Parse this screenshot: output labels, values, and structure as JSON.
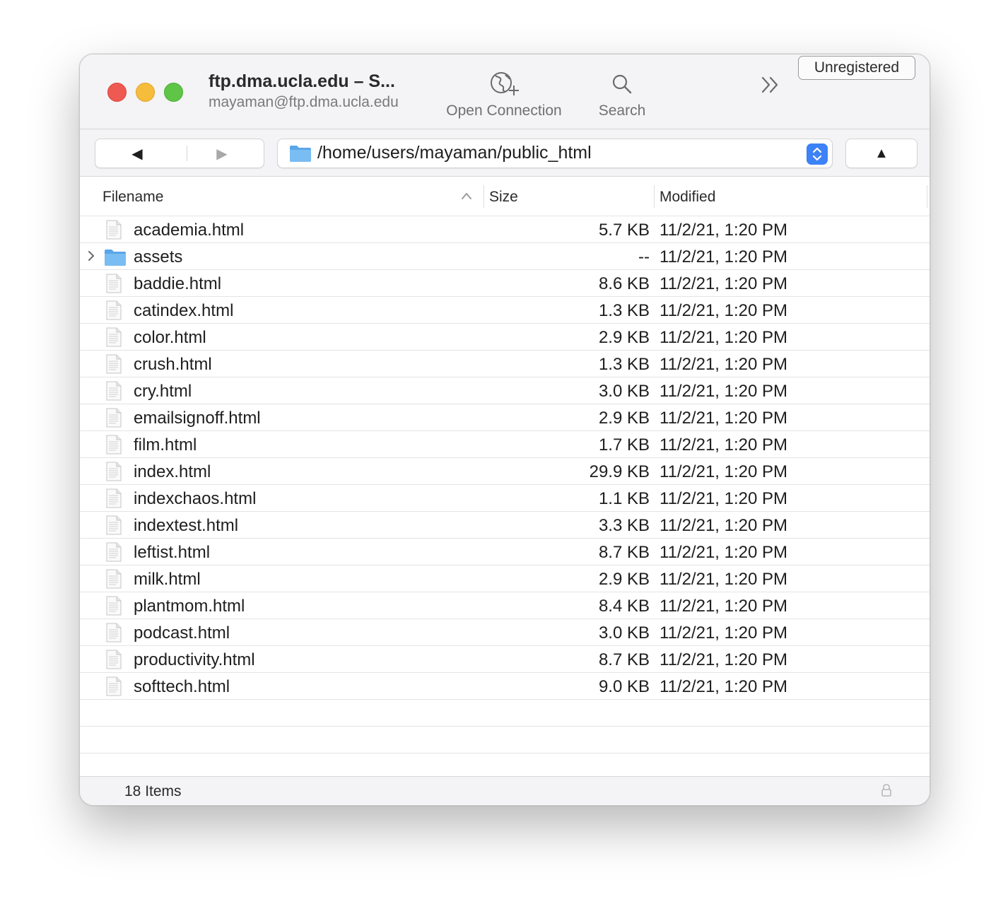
{
  "window": {
    "title": "ftp.dma.ucla.edu – S...",
    "subtitle": "mayaman@ftp.dma.ucla.edu"
  },
  "toolbar": {
    "open_connection_label": "Open Connection",
    "search_label": "Search",
    "unregistered_label": "Unregistered"
  },
  "navigation": {
    "back_glyph": "◀",
    "forward_glyph": "▶",
    "path": "/home/users/mayaman/public_html",
    "up_glyph": "▲"
  },
  "table": {
    "columns": [
      "Filename",
      "Size",
      "Modified"
    ],
    "sort_column": "Filename",
    "rows": [
      {
        "name": "academia.html",
        "size": "5.7 KB",
        "modified": "11/2/21, 1:20 PM",
        "type": "file"
      },
      {
        "name": "assets",
        "size": "--",
        "modified": "11/2/21, 1:20 PM",
        "type": "folder"
      },
      {
        "name": "baddie.html",
        "size": "8.6 KB",
        "modified": "11/2/21, 1:20 PM",
        "type": "file"
      },
      {
        "name": "catindex.html",
        "size": "1.3 KB",
        "modified": "11/2/21, 1:20 PM",
        "type": "file"
      },
      {
        "name": "color.html",
        "size": "2.9 KB",
        "modified": "11/2/21, 1:20 PM",
        "type": "file"
      },
      {
        "name": "crush.html",
        "size": "1.3 KB",
        "modified": "11/2/21, 1:20 PM",
        "type": "file"
      },
      {
        "name": "cry.html",
        "size": "3.0 KB",
        "modified": "11/2/21, 1:20 PM",
        "type": "file"
      },
      {
        "name": "emailsignoff.html",
        "size": "2.9 KB",
        "modified": "11/2/21, 1:20 PM",
        "type": "file"
      },
      {
        "name": "film.html",
        "size": "1.7 KB",
        "modified": "11/2/21, 1:20 PM",
        "type": "file"
      },
      {
        "name": "index.html",
        "size": "29.9 KB",
        "modified": "11/2/21, 1:20 PM",
        "type": "file"
      },
      {
        "name": "indexchaos.html",
        "size": "1.1 KB",
        "modified": "11/2/21, 1:20 PM",
        "type": "file"
      },
      {
        "name": "indextest.html",
        "size": "3.3 KB",
        "modified": "11/2/21, 1:20 PM",
        "type": "file"
      },
      {
        "name": "leftist.html",
        "size": "8.7 KB",
        "modified": "11/2/21, 1:20 PM",
        "type": "file"
      },
      {
        "name": "milk.html",
        "size": "2.9 KB",
        "modified": "11/2/21, 1:20 PM",
        "type": "file"
      },
      {
        "name": "plantmom.html",
        "size": "8.4 KB",
        "modified": "11/2/21, 1:20 PM",
        "type": "file"
      },
      {
        "name": "podcast.html",
        "size": "3.0 KB",
        "modified": "11/2/21, 1:20 PM",
        "type": "file"
      },
      {
        "name": "productivity.html",
        "size": "8.7 KB",
        "modified": "11/2/21, 1:20 PM",
        "type": "file"
      },
      {
        "name": "softtech.html",
        "size": "9.0 KB",
        "modified": "11/2/21, 1:20 PM",
        "type": "file"
      }
    ]
  },
  "status": {
    "item_count": "18 Items"
  },
  "icons": {
    "traffic_red": "close-icon",
    "traffic_yellow": "minimize-icon",
    "traffic_green": "zoom-icon",
    "open_connection": "globe-plus-icon",
    "search": "search-icon",
    "overflow": "chevron-double-right-icon",
    "path_folder": "folder-icon",
    "path_stepper": "stepper-icon",
    "file": "document-icon",
    "folder": "folder-icon",
    "disclosure": "chevron-right-icon",
    "sort": "chevron-up-icon",
    "lock": "lock-icon"
  },
  "colors": {
    "accent": "#3d82f6",
    "folder": "#6bb3ef",
    "traffic_red": "#ee5a52",
    "traffic_yellow": "#f5bd3b",
    "traffic_green": "#5ec547"
  }
}
